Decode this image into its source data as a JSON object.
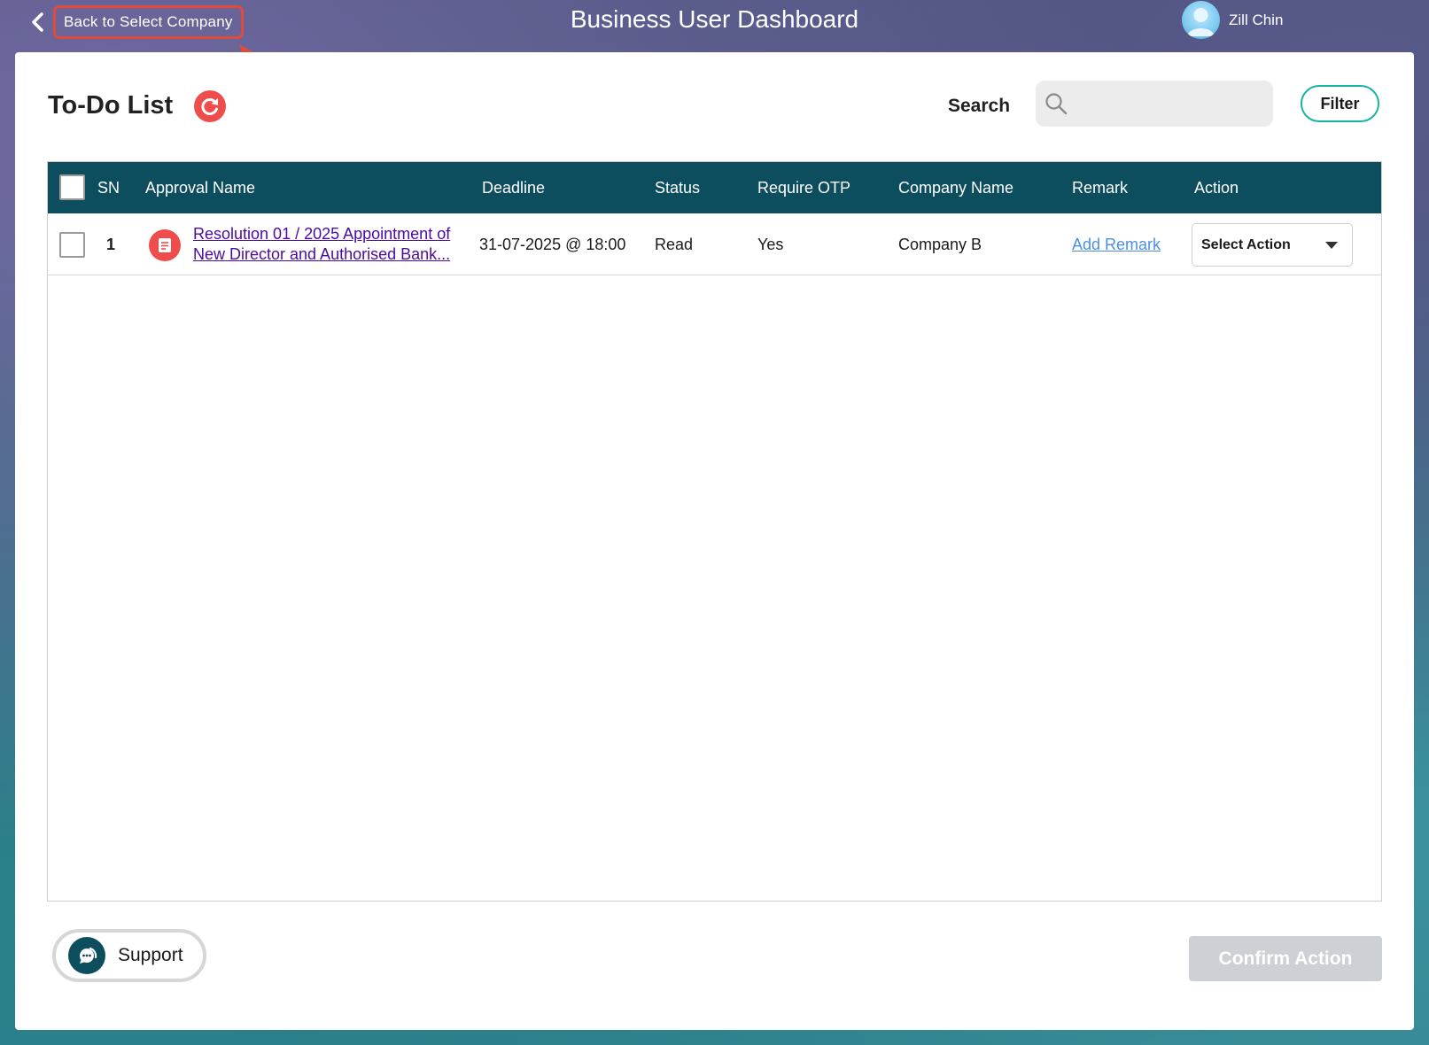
{
  "header": {
    "back_label": "Back to Select Company",
    "title": "Business User Dashboard",
    "user_name": "Zill Chin"
  },
  "todo": {
    "title": "To-Do List",
    "search_label": "Search",
    "search_value": "",
    "search_placeholder": "",
    "filter_label": "Filter"
  },
  "table": {
    "columns": [
      "SN",
      "Approval Name",
      "Deadline",
      "Status",
      "Require OTP",
      "Company Name",
      "Remark",
      "Action"
    ],
    "rows": [
      {
        "sn": "1",
        "approval_name_line1": "Resolution 01 / 2025 Appointment of",
        "approval_name_line2": "New Director and Authorised Bank...",
        "deadline": "31-07-2025 @ 18:00",
        "status": "Read",
        "require_otp": "Yes",
        "company_name": "Company B",
        "remark": "Add Remark",
        "action": "Select Action"
      }
    ]
  },
  "footer": {
    "support_label": "Support",
    "confirm_label": "Confirm Action"
  },
  "colors": {
    "table_header": "#0c4d5e",
    "accent_red": "#ef4c4c",
    "filter_border": "#19b3a5",
    "link_purple": "#4b0aa0",
    "link_blue": "#4a90e2",
    "annotation_red": "#e04b3c"
  },
  "icons": [
    "chevron-left-icon",
    "avatar-icon",
    "refresh-icon",
    "search-icon",
    "document-icon",
    "caret-down-icon",
    "chat-icon",
    "annotation-arrow-icon"
  ]
}
